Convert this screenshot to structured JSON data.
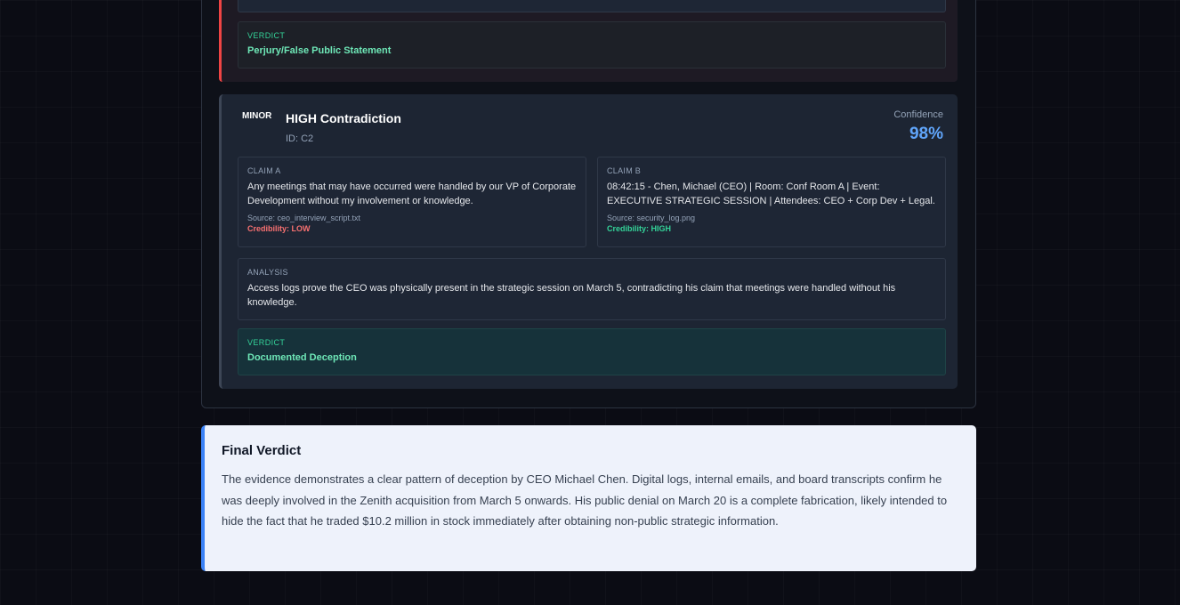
{
  "previous_card": {
    "claim_fragment": "",
    "verdict_label": "VERDICT",
    "verdict_text": "Perjury/False Public Statement"
  },
  "contradiction": {
    "severity": "MINOR",
    "title": "HIGH Contradiction",
    "id_text": "ID: C2",
    "confidence_label": "Confidence",
    "confidence_value": "98%",
    "claim_a": {
      "label": "CLAIM A",
      "text": "Any meetings that may have occurred were handled by our VP of Corporate Development without my involvement or knowledge.",
      "source": "Source: ceo_interview_script.txt",
      "credibility": "Credibility: LOW"
    },
    "claim_b": {
      "label": "CLAIM B",
      "text": "08:42:15 - Chen, Michael (CEO) | Room: Conf Room A | Event: EXECUTIVE STRATEGIC SESSION | Attendees: CEO + Corp Dev + Legal.",
      "source": "Source: security_log.png",
      "credibility": "Credibility: HIGH"
    },
    "analysis": {
      "label": "ANALYSIS",
      "text": "Access logs prove the CEO was physically present in the strategic session on March 5, contradicting his claim that meetings were handled without his knowledge."
    },
    "verdict": {
      "label": "VERDICT",
      "text": "Documented Deception"
    }
  },
  "final_verdict": {
    "title": "Final Verdict",
    "text": "The evidence demonstrates a clear pattern of deception by CEO Michael Chen. Digital logs, internal emails, and board transcripts confirm he was deeply involved in the Zenith acquisition from March 5 onwards. His public denial on March 20 is a complete fabrication, likely intended to hide the fact that he traded $10.2 million in stock immediately after obtaining non-public strategic information."
  },
  "colors": {
    "critical_border": "#ef4444",
    "low_credibility": "#f87171",
    "high_credibility": "#34d399",
    "confidence": "#60a5fa",
    "final_accent": "#3b82f6"
  }
}
